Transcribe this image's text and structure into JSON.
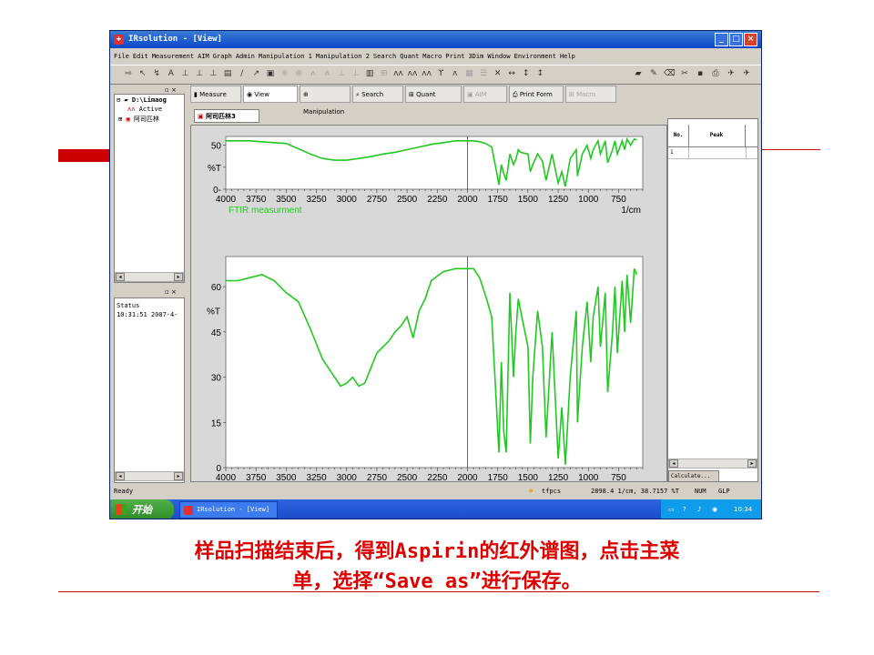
{
  "window": {
    "title": "IRsolution - [View]",
    "controls": {
      "minimize": "_",
      "maximize": "□",
      "close": "×"
    }
  },
  "menu": [
    "File",
    "Edit",
    "Measurement",
    "AIM",
    "Graph",
    "Admin",
    "Manipulation 1",
    "Manipulation 2",
    "Search",
    "Quant",
    "Macro",
    "Print",
    "3Dim",
    "Window",
    "Environment",
    "Help"
  ],
  "tabs": [
    {
      "label": "Measure",
      "enabled": true
    },
    {
      "label": "View",
      "enabled": true,
      "selected": true
    },
    {
      "label": "Manipulation",
      "enabled": true
    },
    {
      "label": "Search",
      "enabled": true
    },
    {
      "label": "Quant",
      "enabled": true
    },
    {
      "label": "AIM",
      "enabled": false
    },
    {
      "label": "Print Form",
      "enabled": true
    },
    {
      "label": "Macro",
      "enabled": false
    }
  ],
  "tree": {
    "root": "D:\\Limaog",
    "active": "Active",
    "sample": "阿司匹林"
  },
  "status_panel": {
    "header": "Status",
    "entry": "10:31:51 2007-4-"
  },
  "doc_tab": "阿司匹林3",
  "peak_table": {
    "col_no": "No.",
    "col_peak": "Peak",
    "row1": "1",
    "calc_button": "Calculate..."
  },
  "statusbar": {
    "ready": "Ready",
    "user": "tfpcs",
    "cursor": "2898.4 1/cm,  38.7157 %T",
    "num": "NUM",
    "glp": "GLP"
  },
  "taskbar": {
    "start": "开始",
    "item": "IRsolution - [View]",
    "time": "10:34"
  },
  "caption": {
    "line1": "样品扫描结束后，得到Aspirin的红外谱图，点击主菜",
    "line2": "单，选择“Save as”进行保存。"
  },
  "colors": {
    "spectrum": "#22c822",
    "caption": "#dd0000",
    "deco": "#cc0000"
  },
  "chart_data": [
    {
      "type": "line",
      "xlabel": "1/cm",
      "ylabel": "%T",
      "annotation": "FTIR measurment",
      "xlim": [
        4000,
        550
      ],
      "ylim": [
        0,
        60
      ],
      "xticks": [
        4000,
        3750,
        3500,
        3250,
        3000,
        2750,
        2500,
        2250,
        2000,
        1750,
        1500,
        1250,
        1000,
        750
      ],
      "yticks": [
        0,
        25,
        50
      ],
      "ytick_labels": [
        "0-",
        "%T",
        "50"
      ],
      "cursor_x": 2000,
      "series": [
        {
          "x": [
            4000,
            3900,
            3800,
            3700,
            3600,
            3500,
            3400,
            3300,
            3200,
            3100,
            3000,
            2900,
            2800,
            2700,
            2600,
            2500,
            2400,
            2300,
            2200,
            2100,
            2000,
            1950,
            1900,
            1850,
            1800,
            1760,
            1740,
            1720,
            1700,
            1680,
            1650,
            1620,
            1600,
            1580,
            1560,
            1500,
            1480,
            1460,
            1420,
            1380,
            1350,
            1300,
            1250,
            1220,
            1190,
            1150,
            1100,
            1090,
            1050,
            1010,
            980,
            960,
            920,
            900,
            860,
            840,
            800,
            780,
            760,
            720,
            700,
            680,
            650,
            620,
            600
          ],
          "y": [
            55,
            55,
            55,
            54,
            53,
            52,
            46,
            40,
            35,
            33,
            33,
            35,
            37,
            40,
            42,
            45,
            48,
            51,
            53,
            55,
            55,
            55,
            54,
            52,
            48,
            20,
            5,
            28,
            18,
            10,
            40,
            28,
            34,
            45,
            42,
            40,
            20,
            28,
            40,
            32,
            10,
            40,
            7,
            20,
            3,
            35,
            45,
            15,
            40,
            50,
            35,
            45,
            55,
            40,
            55,
            30,
            45,
            55,
            40,
            55,
            45,
            57,
            50,
            57,
            56
          ]
        }
      ]
    },
    {
      "type": "line",
      "xlabel": "1/cm",
      "ylabel": "%T",
      "annotation": "FTIR measurment",
      "xlim": [
        4000,
        550
      ],
      "ylim": [
        0,
        70
      ],
      "xticks": [
        4000,
        3750,
        3500,
        3250,
        3000,
        2750,
        2500,
        2250,
        2000,
        1750,
        1500,
        1250,
        1000,
        750
      ],
      "yticks": [
        0,
        15,
        30,
        45,
        60
      ],
      "ytick_labels": [
        "0",
        "15",
        "30",
        "45",
        "60"
      ],
      "cursor_x": 2000,
      "series": [
        {
          "x": [
            4000,
            3900,
            3800,
            3700,
            3600,
            3500,
            3400,
            3300,
            3200,
            3100,
            3050,
            3000,
            2950,
            2900,
            2850,
            2800,
            2750,
            2700,
            2650,
            2600,
            2550,
            2500,
            2450,
            2400,
            2350,
            2300,
            2200,
            2100,
            2000,
            1950,
            1900,
            1850,
            1800,
            1760,
            1740,
            1720,
            1700,
            1680,
            1650,
            1620,
            1600,
            1580,
            1560,
            1500,
            1480,
            1460,
            1420,
            1380,
            1350,
            1300,
            1250,
            1220,
            1190,
            1150,
            1100,
            1090,
            1050,
            1010,
            980,
            960,
            920,
            900,
            860,
            840,
            800,
            780,
            760,
            720,
            700,
            680,
            650,
            620,
            600
          ],
          "y": [
            62,
            62,
            63,
            64,
            62,
            58,
            55,
            46,
            36,
            30,
            27,
            28,
            30,
            27,
            28,
            33,
            38,
            40,
            42,
            45,
            47,
            50,
            43,
            52,
            56,
            62,
            65,
            66,
            66,
            66,
            63,
            57,
            50,
            20,
            5,
            35,
            12,
            5,
            58,
            30,
            45,
            56,
            52,
            40,
            8,
            30,
            52,
            40,
            10,
            45,
            3,
            20,
            1,
            30,
            52,
            15,
            40,
            55,
            35,
            50,
            60,
            40,
            58,
            25,
            45,
            60,
            38,
            62,
            45,
            64,
            48,
            66,
            64
          ]
        }
      ]
    }
  ]
}
